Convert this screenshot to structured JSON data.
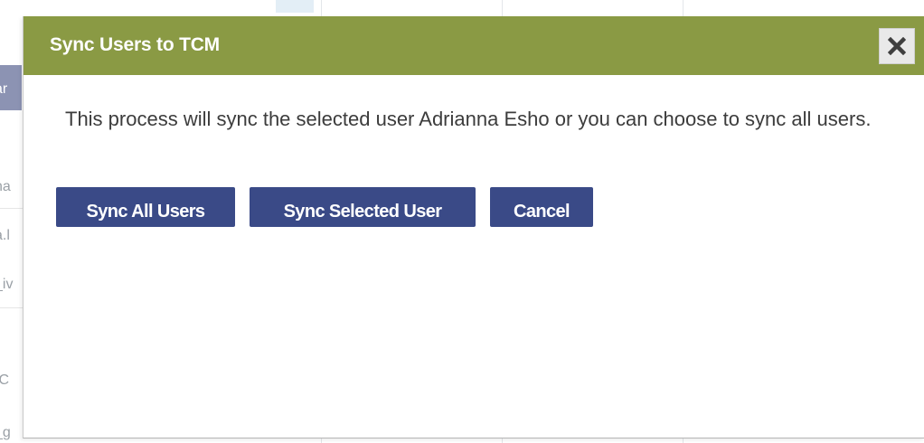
{
  "background": {
    "fragments": [
      "ar",
      "na",
      "a.l",
      "_iv",
      ":C",
      "_g"
    ]
  },
  "dialog": {
    "title": "Sync Users to TCM",
    "close_icon": "close-icon",
    "message": "This process will sync the selected user Adrianna Esho or you can choose to sync all users.",
    "buttons": {
      "sync_all": "Sync All Users",
      "sync_selected": "Sync Selected User",
      "cancel": "Cancel"
    }
  },
  "colors": {
    "header": "#8a9a44",
    "button": "#3a4a87",
    "title_text": "#ffffff"
  }
}
